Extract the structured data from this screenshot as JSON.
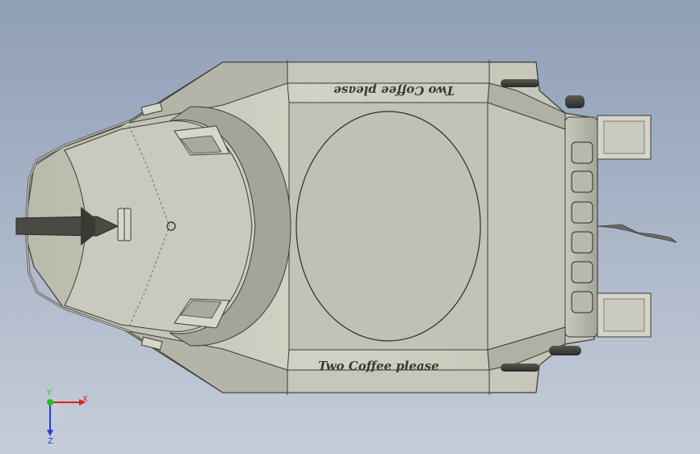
{
  "viewport": {
    "background_top": "#8f9fb6",
    "background_bottom": "#c6cdd9"
  },
  "model": {
    "hull_color": "#c9c9bd",
    "deck_color": "#c2c2b6",
    "edge_color": "#3c3c36",
    "text_top": "Two Coffee please",
    "text_bottom": "Two Coffee please"
  },
  "triad": {
    "x_label": "X",
    "y_label": "Y",
    "z_label": "Z",
    "x_color": "#e02020",
    "y_color": "#20c020",
    "z_color": "#2040e0"
  }
}
